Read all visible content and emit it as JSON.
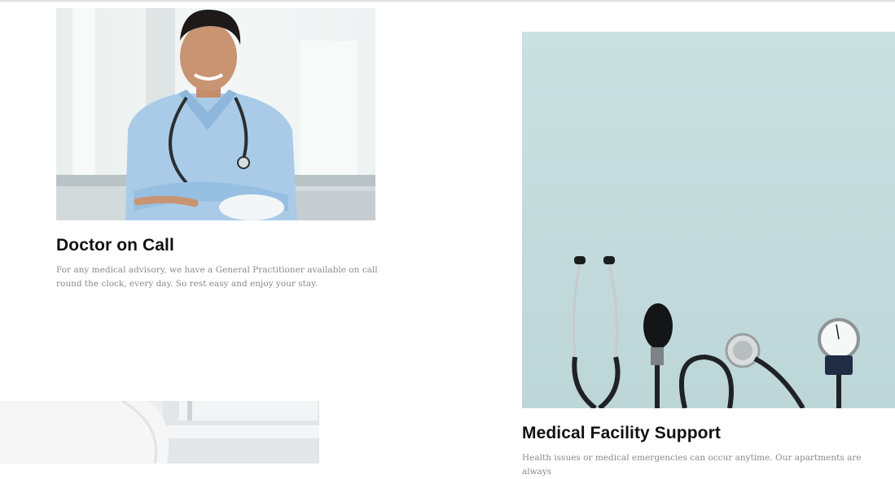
{
  "services": [
    {
      "title": "Doctor on Call",
      "description": "For any medical advisory, we have a General Practitioner available on call round the clock, every day. So rest easy and enjoy your stay.",
      "image": "doctor-photo"
    },
    {
      "title": "Medical Facility Support",
      "description": "Health issues or medical emergencies can occur anytime. Our apartments are always",
      "image": "stethoscope-blood-pressure-photo"
    },
    {
      "image": "medical-consultation-photo"
    }
  ],
  "colors": {
    "title": "#111111",
    "description": "#8a8a8a",
    "photo_teal": "#cfe3e3"
  }
}
